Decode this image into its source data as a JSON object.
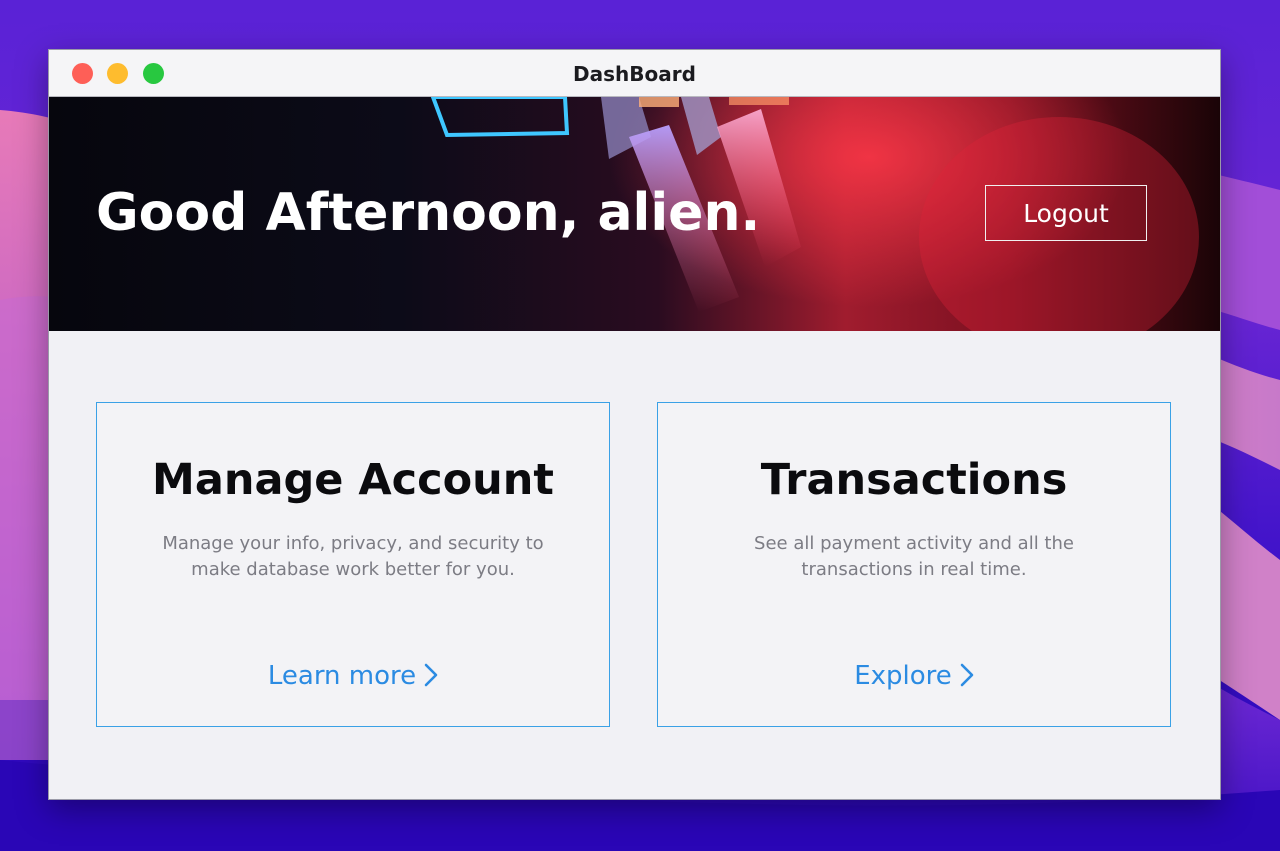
{
  "window": {
    "title": "DashBoard"
  },
  "header": {
    "greeting": "Good Afternoon, alien.",
    "logout_label": "Logout"
  },
  "cards": [
    {
      "title": "Manage Account",
      "description": "Manage your info, privacy, and security to make database work better for you.",
      "link_label": "Learn more",
      "link_icon": "chevron-right-icon"
    },
    {
      "title": "Transactions",
      "description": "See all payment activity and all the transactions in real time.",
      "link_label": "Explore",
      "link_icon": "chevron-right-icon"
    }
  ],
  "colors": {
    "accent": "#2b8be2",
    "card_border": "#3aa1e6",
    "traffic_close": "#fe5f57",
    "traffic_minimize": "#febc2e",
    "traffic_maximize": "#28c840"
  }
}
